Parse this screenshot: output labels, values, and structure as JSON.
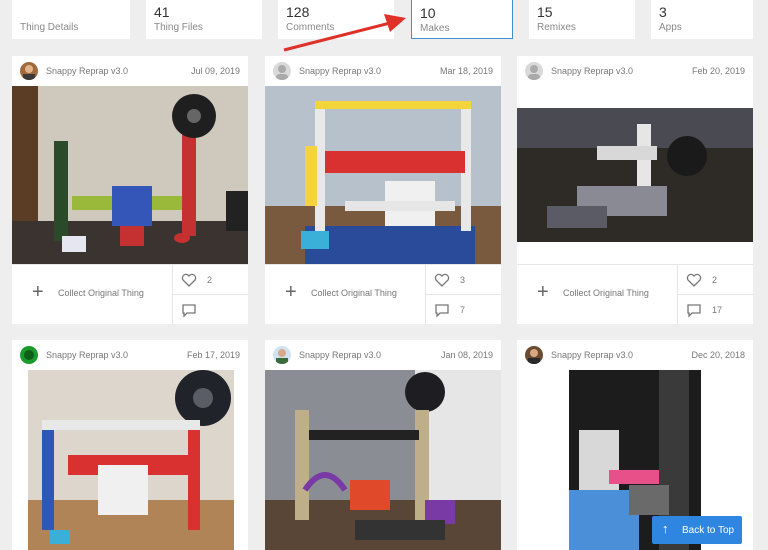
{
  "tabs": [
    {
      "count": "",
      "label": "Thing Details"
    },
    {
      "count": "41",
      "label": "Thing Files"
    },
    {
      "count": "128",
      "label": "Comments"
    },
    {
      "count": "10",
      "label": "Makes"
    },
    {
      "count": "15",
      "label": "Remixes"
    },
    {
      "count": "3",
      "label": "Apps"
    }
  ],
  "collect_label": "Collect Original Thing",
  "cards": [
    {
      "user": "Snappy Reprap v3.0",
      "date": "Jul 09, 2019",
      "likes": "2",
      "comments": ""
    },
    {
      "user": "Snappy Reprap v3.0",
      "date": "Mar 18, 2019",
      "likes": "3",
      "comments": "7"
    },
    {
      "user": "Snappy Reprap v3.0",
      "date": "Feb 20, 2019",
      "likes": "2",
      "comments": "17"
    },
    {
      "user": "Snappy Reprap v3.0",
      "date": "Feb 17, 2019"
    },
    {
      "user": "Snappy Reprap v3.0",
      "date": "Jan 08, 2019"
    },
    {
      "user": "Snappy Reprap v3.0",
      "date": "Dec 20, 2018"
    }
  ],
  "back_to_top": "Back to Top",
  "icons": {
    "add": "plus-icon",
    "like": "heart-icon",
    "comment": "comment-icon",
    "up": "arrow-up-icon"
  },
  "colors": {
    "accent": "#2f86e0",
    "arrow": "#e0302a",
    "active_border": "#3f8fd2"
  }
}
